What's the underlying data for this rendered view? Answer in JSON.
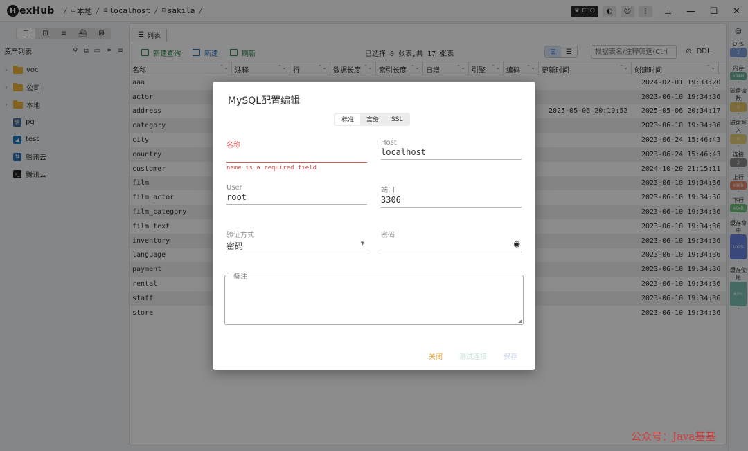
{
  "app": {
    "logo_letter": "H",
    "logo_text": "exHub"
  },
  "breadcrumb": [
    {
      "icon": "folder-icon",
      "label": "本地"
    },
    {
      "icon": "server-icon",
      "label": "localhost"
    },
    {
      "icon": "database-icon",
      "label": "sakila"
    }
  ],
  "topbar": {
    "ceo_label": "CEO"
  },
  "sidebar": {
    "title": "资产列表",
    "items": [
      {
        "type": "folder",
        "label": "voc"
      },
      {
        "type": "folder",
        "label": "公司"
      },
      {
        "type": "folder",
        "label": "本地"
      },
      {
        "type": "postgres",
        "label": "pg",
        "color": "#3b6ea5"
      },
      {
        "type": "sqlite",
        "label": "test",
        "color": "#1a7bc4"
      },
      {
        "type": "sftp",
        "label": "腾讯云",
        "color": "#2f6db5"
      },
      {
        "type": "terminal",
        "label": "腾讯云",
        "color": "#222222"
      }
    ]
  },
  "main": {
    "tab_label": "列表",
    "toolbar": {
      "new_query": "新建查询",
      "new": "新建",
      "refresh": "刷新",
      "selection_info": "已选择 0 张表,共 17 张表",
      "filter_placeholder": "根据表名/注释筛选(Ctrl",
      "ddl": "DDL"
    },
    "columns": [
      "名称",
      "注释",
      "行",
      "数据长度",
      "索引长度",
      "自增",
      "引擎",
      "编码",
      "更新时间",
      "创建时间"
    ],
    "rows": [
      {
        "name": "aaa",
        "updated": "",
        "created": "2024-02-01 19:33:20"
      },
      {
        "name": "actor",
        "updated": "",
        "created": "2023-06-10 19:34:36"
      },
      {
        "name": "address",
        "updated": "2025-05-06 20:19:52",
        "created": "2025-05-06 20:34:17"
      },
      {
        "name": "category",
        "updated": "",
        "created": "2023-06-10 19:34:36"
      },
      {
        "name": "city",
        "updated": "",
        "created": "2023-06-24 15:46:43"
      },
      {
        "name": "country",
        "updated": "",
        "created": "2023-06-24 15:46:43"
      },
      {
        "name": "customer",
        "updated": "",
        "created": "2024-10-20 21:15:11"
      },
      {
        "name": "film",
        "updated": "",
        "created": "2023-06-10 19:34:36"
      },
      {
        "name": "film_actor",
        "updated": "",
        "created": "2023-06-10 19:34:36"
      },
      {
        "name": "film_category",
        "updated": "",
        "created": "2023-06-10 19:34:36"
      },
      {
        "name": "film_text",
        "updated": "",
        "created": "2023-06-10 19:34:36"
      },
      {
        "name": "inventory",
        "updated": "",
        "created": "2023-06-10 19:34:36"
      },
      {
        "name": "language",
        "updated": "",
        "created": "2023-06-10 19:34:36"
      },
      {
        "name": "payment",
        "updated": "",
        "created": "2023-06-10 19:34:36"
      },
      {
        "name": "rental",
        "updated": "",
        "created": "2023-06-10 19:34:36"
      },
      {
        "name": "staff",
        "updated": "",
        "created": "2023-06-10 19:34:36"
      },
      {
        "name": "store",
        "updated": "",
        "created": "2023-06-10 19:34:36"
      }
    ]
  },
  "metrics": [
    {
      "label": "QPS",
      "value": "2",
      "color": "#7f9fd6"
    },
    {
      "label": "内存",
      "value": "434M",
      "color": "#6fae9a"
    },
    {
      "label": "磁盘读数",
      "value": "0",
      "color": "#e6c36a"
    },
    {
      "label": "磁盘写入",
      "value": "0",
      "color": "#e6d07a"
    },
    {
      "label": "连接",
      "value": "2",
      "color": "#888888"
    },
    {
      "label": "上行",
      "value": "698B",
      "color": "#e0846a"
    },
    {
      "label": "下行",
      "value": "464B",
      "color": "#6fbf7a"
    },
    {
      "label": "缓存命中",
      "value": "100%",
      "color": "#6a82e0"
    },
    {
      "label": "缓存使用",
      "value": "63%",
      "color": "#7fc2b4"
    }
  ],
  "modal": {
    "title": "MySQL配置编辑",
    "tabs": [
      "标准",
      "高级",
      "SSL"
    ],
    "fields": {
      "name": {
        "label": "名称",
        "value": "",
        "error": "name is a required field"
      },
      "host": {
        "label": "Host",
        "value": "localhost"
      },
      "user": {
        "label": "User",
        "value": "root"
      },
      "port": {
        "label": "端口",
        "value": "3306"
      },
      "auth": {
        "label": "验证方式",
        "value": "密码"
      },
      "password": {
        "label": "密码",
        "value": ""
      },
      "notes": {
        "label": "备注",
        "value": ""
      }
    },
    "buttons": {
      "close": "关闭",
      "test": "测试连接",
      "save": "保存"
    }
  },
  "watermark": "公众号：Java基基"
}
